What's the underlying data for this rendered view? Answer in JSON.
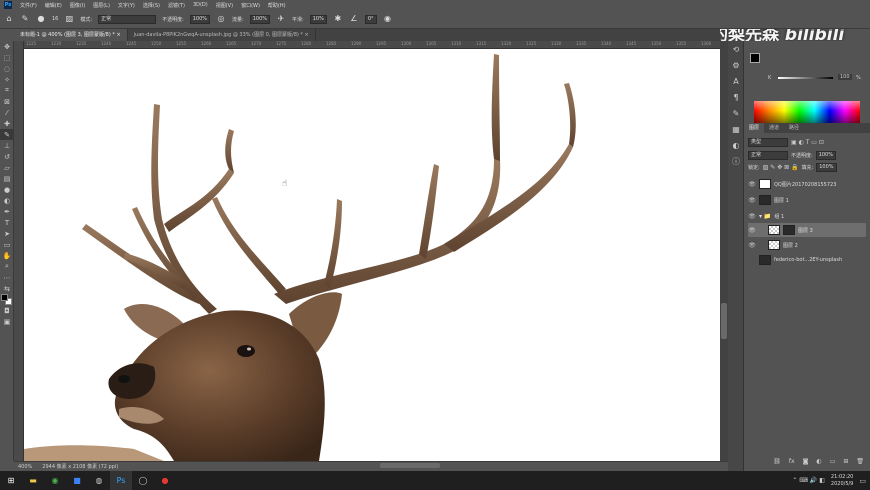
{
  "menubar": {
    "app_icon": "Ps",
    "items": [
      "文件(F)",
      "编辑(E)",
      "图像(I)",
      "图层(L)",
      "文字(Y)",
      "选择(S)",
      "滤镜(T)",
      "3D(D)",
      "视图(V)",
      "窗口(W)",
      "帮助(H)"
    ]
  },
  "options": {
    "brush_size": "16",
    "mode_label": "模式:",
    "mode_value": "正常",
    "opacity_label": "不透明度:",
    "opacity_value": "100%",
    "flow_label": "流量:",
    "flow_value": "100%",
    "smooth_label": "平滑:",
    "smooth_value": "10%",
    "angle_value": "0°"
  },
  "tabs": [
    {
      "label": "未标题-1 @ 400% (图层 3, 图层蒙版/8) * ×",
      "active": true
    },
    {
      "label": "juan-davila-P8PlK2nGwqA-unsplash.jpg @ 33% (图层 0, 图层蒙版/8) * ×",
      "active": false
    }
  ],
  "ruler_top": [
    "1225",
    "1230",
    "1235",
    "1240",
    "1245",
    "1250",
    "1255",
    "1260",
    "1265",
    "1270",
    "1275",
    "1280",
    "1285",
    "1290",
    "1295",
    "1300",
    "1305",
    "1310",
    "1315",
    "1320",
    "1325",
    "1330",
    "1335",
    "1340",
    "1345",
    "1350",
    "1355",
    "1360"
  ],
  "status": {
    "zoom": "400%",
    "doc_info": "2944 像素 x 2108 像素 (72 ppi)"
  },
  "watermark": "做设计的梨先森",
  "watermark_brand": "bilibili",
  "color_panel": {
    "k_label": "K",
    "k_value": "100",
    "percent": "%"
  },
  "panel_tabs": [
    "图层",
    "通道",
    "路径"
  ],
  "layer_filter": {
    "kind_label": "类型",
    "blend_mode": "正常",
    "opacity_label": "不透明度:",
    "opacity_value": "100%",
    "lock_label": "锁定:",
    "fill_label": "填充:",
    "fill_value": "100%"
  },
  "layers": [
    {
      "name": "QQ图片20170208155723",
      "thumb": "white",
      "selected": false,
      "indent": false
    },
    {
      "name": "图层 1",
      "thumb": "dark",
      "selected": false,
      "indent": false
    },
    {
      "name": "组 1",
      "thumb": "folder",
      "selected": false,
      "indent": false
    },
    {
      "name": "图层 3",
      "thumb": "check",
      "selected": true,
      "indent": true
    },
    {
      "name": "图层 2",
      "thumb": "check",
      "selected": false,
      "indent": true
    },
    {
      "name": "federico-bot...2EY-unsplash",
      "thumb": "dark",
      "selected": false,
      "indent": false
    }
  ],
  "taskbar": {
    "time": "21:02:20",
    "date": "2020/5/9"
  },
  "colors": {
    "ui_bg": "#535353",
    "taskbar_bg": "#1f1f1f",
    "selected_layer": "#6e6e6e"
  }
}
